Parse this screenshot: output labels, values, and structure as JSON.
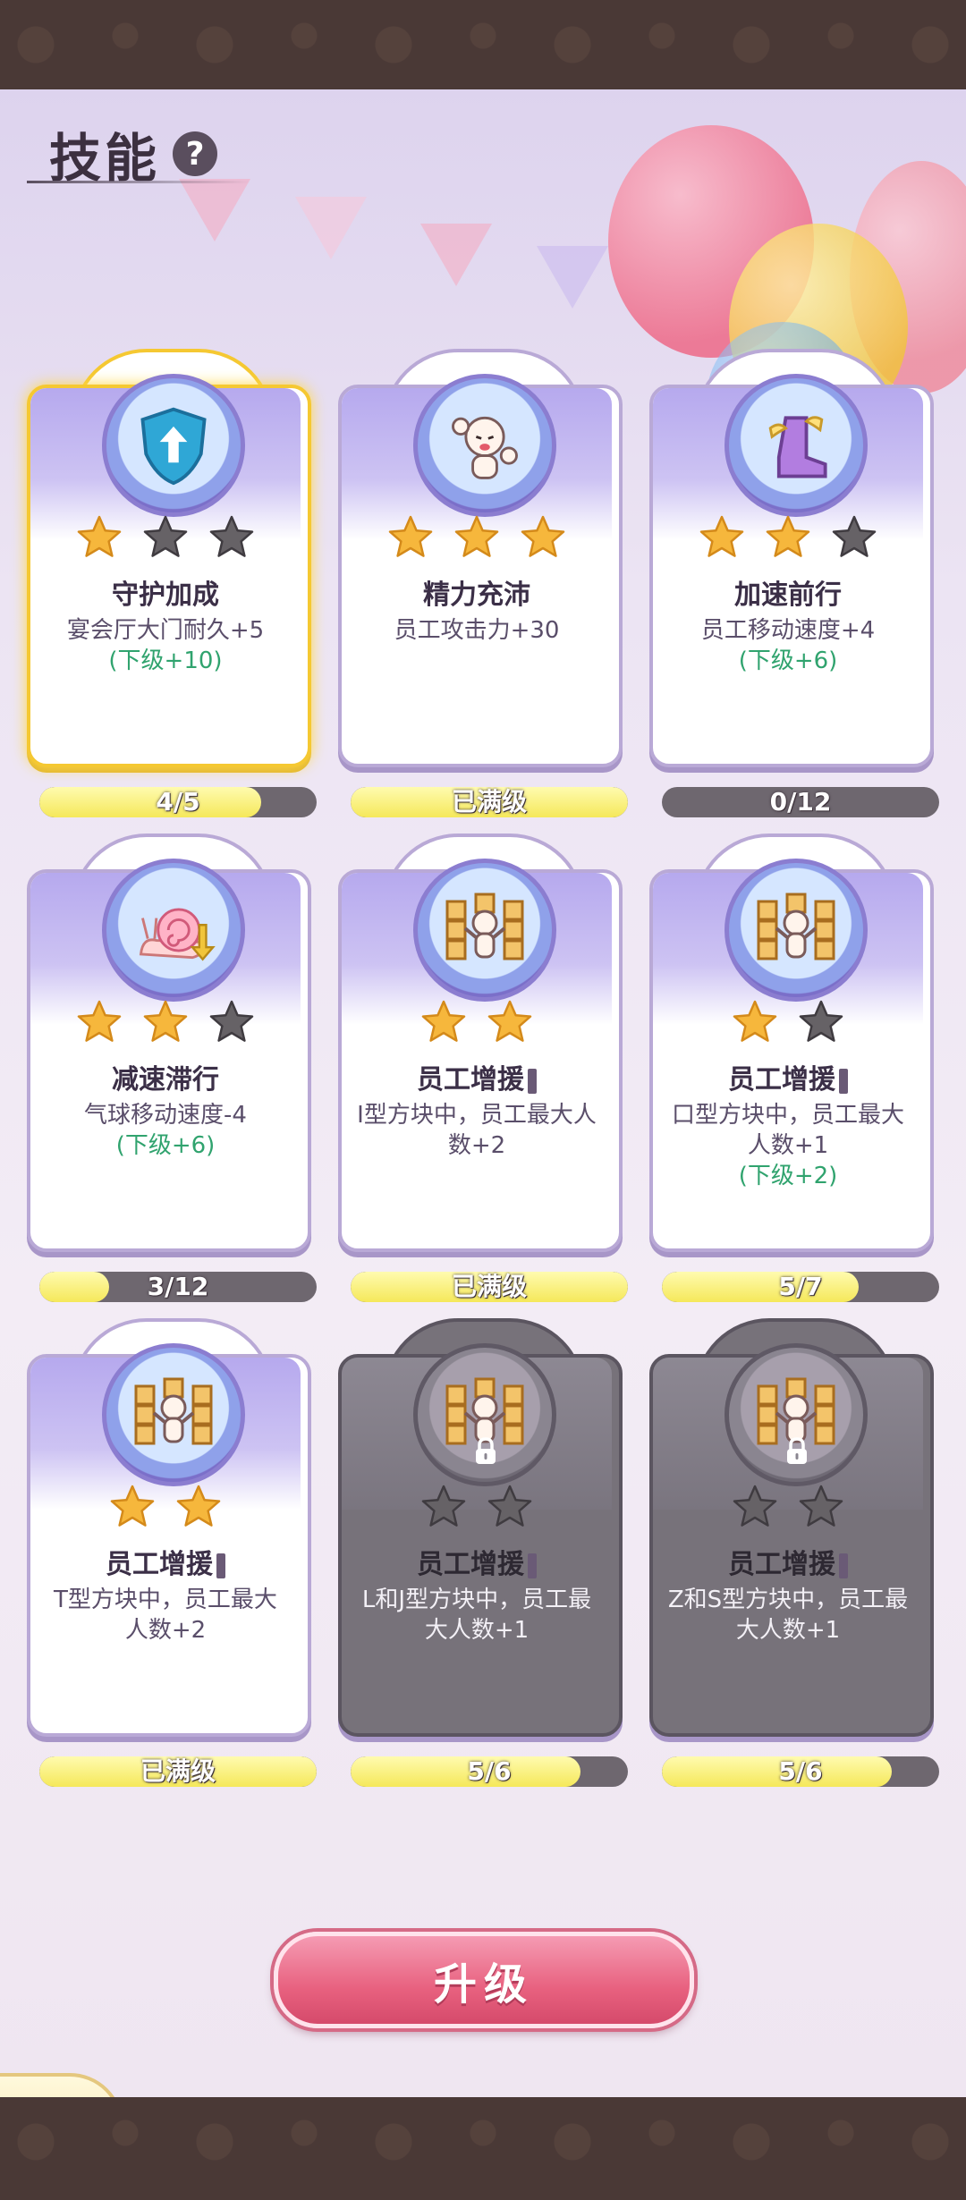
{
  "header": {
    "title": "技能",
    "help": "?"
  },
  "skills": [
    {
      "name": "守护加成",
      "desc": "宴会厅大门耐久+5",
      "next": "(下级+10)",
      "progress": "4/5",
      "fill": 0.8,
      "stars": [
        1,
        0,
        0
      ],
      "icon": "shield-up-icon",
      "locked": false,
      "selected": true
    },
    {
      "name": "精力充沛",
      "desc": "员工攻击力+30",
      "next": "",
      "progress": "已满级",
      "fill": 1.0,
      "stars": [
        1,
        1,
        1
      ],
      "icon": "flex-worker-icon",
      "locked": false,
      "selected": false
    },
    {
      "name": "加速前行",
      "desc": "员工移动速度+4",
      "next": "(下级+6)",
      "progress": "0/12",
      "fill": 0.0,
      "stars": [
        1,
        1,
        0
      ],
      "icon": "winged-boot-icon",
      "locked": false,
      "selected": false
    },
    {
      "name": "减速滞行",
      "desc": "气球移动速度-4",
      "next": "(下级+6)",
      "progress": "3/12",
      "fill": 0.25,
      "stars": [
        1,
        1,
        0
      ],
      "icon": "snail-icon",
      "locked": false,
      "selected": false
    },
    {
      "name": "员工增援",
      "desc": "I型方块中，员工最大人数+2",
      "next": "",
      "progress": "已满级",
      "fill": 1.0,
      "stars": [
        1,
        1
      ],
      "icon": "worker-blocks-icon",
      "locked": false,
      "selected": false
    },
    {
      "name": "员工增援",
      "desc": "口型方块中，员工最大人数+1",
      "next": "(下级+2)",
      "progress": "5/7",
      "fill": 0.71,
      "stars": [
        1,
        0
      ],
      "icon": "worker-blocks-icon",
      "locked": false,
      "selected": false
    },
    {
      "name": "员工增援",
      "desc": "T型方块中，员工最大人数+2",
      "next": "",
      "progress": "已满级",
      "fill": 1.0,
      "stars": [
        1,
        1
      ],
      "icon": "worker-blocks-icon",
      "locked": false,
      "selected": false
    },
    {
      "name": "员工增援",
      "desc": "L和J型方块中，员工最大人数+1",
      "next": "",
      "progress": "5/6",
      "fill": 0.83,
      "stars": [
        0,
        0
      ],
      "icon": "worker-blocks-icon",
      "locked": true,
      "selected": false
    },
    {
      "name": "员工增援",
      "desc": "Z和S型方块中，员工最大人数+1",
      "next": "",
      "progress": "5/6",
      "fill": 0.83,
      "stars": [
        0,
        0
      ],
      "icon": "worker-blocks-icon",
      "locked": true,
      "selected": false
    }
  ],
  "upgrade_label": "升级",
  "colors": {
    "star_on": "#f6b73c",
    "star_off": "#666266",
    "accent": "#e8617f",
    "bar_fill": "#f5e85a"
  }
}
